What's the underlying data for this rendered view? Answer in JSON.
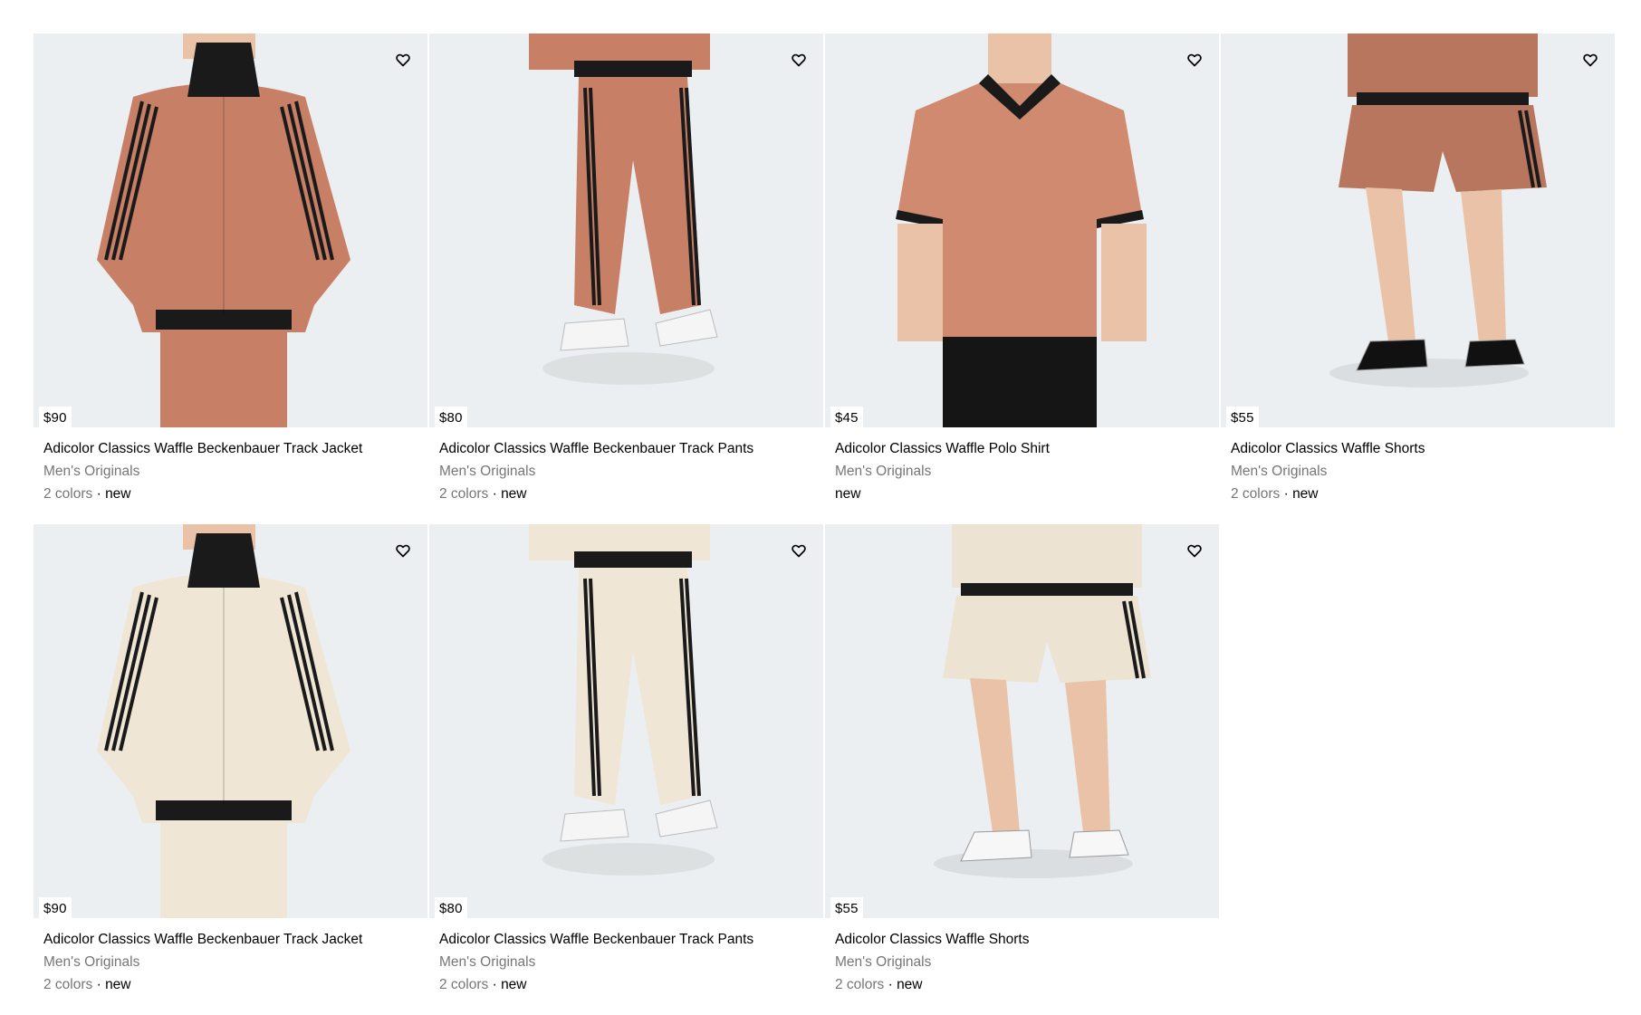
{
  "products": [
    {
      "price": "$90",
      "name": "Adicolor Classics Waffle Beckenbauer Track Jacket",
      "category": "Men's Originals",
      "colors": "2 colors",
      "separator": " · ",
      "badge": "new",
      "kind": "jacket",
      "garment_color": "#c77f66",
      "image_icon": "product-photo-jacket"
    },
    {
      "price": "$80",
      "name": "Adicolor Classics Waffle Beckenbauer Track Pants",
      "category": "Men's Originals",
      "colors": "2 colors",
      "separator": " · ",
      "badge": "new",
      "kind": "pants",
      "garment_color": "#c77f66",
      "image_icon": "product-photo-pants"
    },
    {
      "price": "$45",
      "name": "Adicolor Classics Waffle Polo Shirt",
      "category": "Men's Originals",
      "colors": "",
      "separator": "",
      "badge": "new",
      "kind": "polo",
      "garment_color": "#d08a70",
      "image_icon": "product-photo-polo"
    },
    {
      "price": "$55",
      "name": "Adicolor Classics Waffle Shorts",
      "category": "Men's Originals",
      "colors": "2 colors",
      "separator": " · ",
      "badge": "new",
      "kind": "shorts",
      "garment_color": "#b8765f",
      "image_icon": "product-photo-shorts"
    },
    {
      "price": "$90",
      "name": "Adicolor Classics Waffle Beckenbauer Track Jacket",
      "category": "Men's Originals",
      "colors": "2 colors",
      "separator": " · ",
      "badge": "new",
      "kind": "jacket",
      "garment_color": "#efe6d6",
      "image_icon": "product-photo-jacket"
    },
    {
      "price": "$80",
      "name": "Adicolor Classics Waffle Beckenbauer Track Pants",
      "category": "Men's Originals",
      "colors": "2 colors",
      "separator": " · ",
      "badge": "new",
      "kind": "pants",
      "garment_color": "#efe6d6",
      "image_icon": "product-photo-pants"
    },
    {
      "price": "$55",
      "name": "Adicolor Classics Waffle Shorts",
      "category": "Men's Originals",
      "colors": "2 colors",
      "separator": " · ",
      "badge": "new",
      "kind": "shorts",
      "garment_color": "#ece3d2",
      "image_icon": "product-photo-shorts"
    }
  ],
  "icons": {
    "wishlist": "heart-icon"
  },
  "colors": {
    "image_background": "#eceff1",
    "stripe": "#1a1a1a",
    "muted_text": "#767677",
    "skin": "#e9c2a8"
  }
}
